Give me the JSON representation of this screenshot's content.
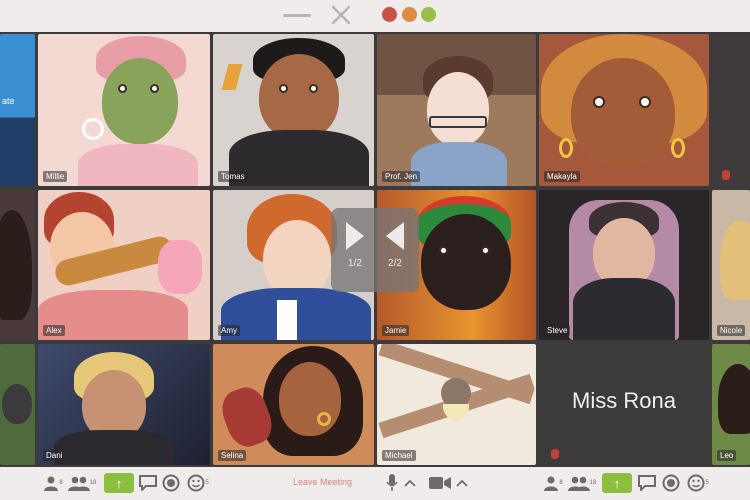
{
  "participants": [
    {
      "name": "Millie"
    },
    {
      "name": "Tomas"
    },
    {
      "name": "Prof. Jen"
    },
    {
      "name": "Makayla"
    },
    {
      "name": "Alex"
    },
    {
      "name": "Amy"
    },
    {
      "name": "Jamie"
    },
    {
      "name": "Steve"
    },
    {
      "name": "Nicole"
    },
    {
      "name": "Dani"
    },
    {
      "name": "Selina"
    },
    {
      "name": "Michael"
    },
    {
      "name": "Miss Rona"
    },
    {
      "name": "Leo"
    }
  ],
  "partial_left_tile": {
    "text": "ate"
  },
  "pager": {
    "prev_label": "1/2",
    "next_label": "2/2"
  },
  "toolbar": {
    "participants_count": "8",
    "group_count": "18",
    "leave_label": "Leave Meeting",
    "reactions_count": "5"
  },
  "icons": [
    "minimize-icon",
    "close-icon",
    "person-icon",
    "group-icon",
    "share-icon",
    "chat-icon",
    "record-icon",
    "emoji-icon",
    "microphone-icon",
    "chevron-up-icon",
    "camera-icon",
    "previous-page-icon",
    "next-page-icon"
  ],
  "colors": {
    "chrome": "#f1ecec",
    "grid_bg": "#3d3a3b",
    "share_green": "#8cbf3f",
    "leave_red": "#d4847c",
    "close_red": "#c85045",
    "min_orange": "#df8b3f",
    "max_green": "#96c04a"
  }
}
